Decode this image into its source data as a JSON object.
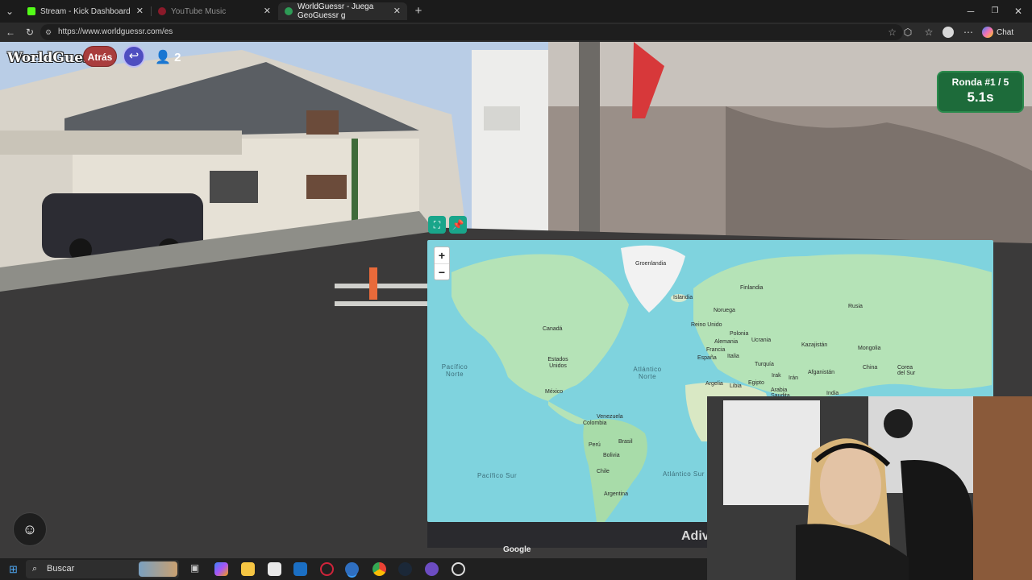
{
  "browser": {
    "tabs": [
      {
        "label": "Stream - Kick Dashboard",
        "state": "normal",
        "color": "#53fc18"
      },
      {
        "label": "YouTube Music",
        "state": "dim",
        "color": "#ff0033"
      },
      {
        "label": "WorldGuessr - Juega GeoGuessr g",
        "state": "active",
        "color": "#2e9c56"
      }
    ],
    "new_tab_label": "+",
    "url": "https://www.worldguessr.com/es",
    "chat_label": "Chat"
  },
  "game": {
    "logo": "WorldGuessr",
    "back_label": "Atrás",
    "players_count": "2",
    "round_label": "Ronda #1 / 5",
    "timer": "5.1s",
    "guess_label": "Adivi",
    "google_label": "Google",
    "colors": {
      "round_bg": "#1d6b3a",
      "back_bg": "#a93d3d",
      "return_bg": "#4e4ec0",
      "map_water": "#7fd3de",
      "land": "#b5e3b7"
    }
  },
  "map": {
    "zoom_in": "+",
    "zoom_out": "−",
    "labels": {
      "groenlandia": "Groenlandia",
      "islandia": "Islandia",
      "finlandia": "Finlandia",
      "noruega": "Noruega",
      "reino_unido": "Reino Unido",
      "polonia": "Polonia",
      "alemania": "Alemania",
      "ucrania": "Ucrania",
      "francia": "Francia",
      "italia": "Italia",
      "espana": "España",
      "rusia": "Rusia",
      "kazajistan": "Kazajistán",
      "mongolia": "Mongolia",
      "china": "China",
      "corea": "Corea del Sur",
      "turquia": "Turquía",
      "irak": "Irak",
      "iran": "Irán",
      "afganistan": "Afganistán",
      "india": "India",
      "argelia": "Argelia",
      "libia": "Libia",
      "egipto": "Egipto",
      "arabia": "Arabia Saudita",
      "canada": "Canadá",
      "eeuu": "Estados Unidos",
      "mexico": "México",
      "venezuela": "Venezuela",
      "colombia": "Colombia",
      "peru": "Perú",
      "brasil": "Brasil",
      "bolivia": "Bolivia",
      "chile": "Chile",
      "argentina": "Argentina",
      "pacifico_norte": "Pacífico Norte",
      "atlantico_norte": "Atlántico Norte",
      "pacifico_sur": "Pacífico Sur",
      "atlantico_sur": "Atlántico Sur"
    }
  },
  "taskbar": {
    "search_placeholder": "Buscar"
  }
}
